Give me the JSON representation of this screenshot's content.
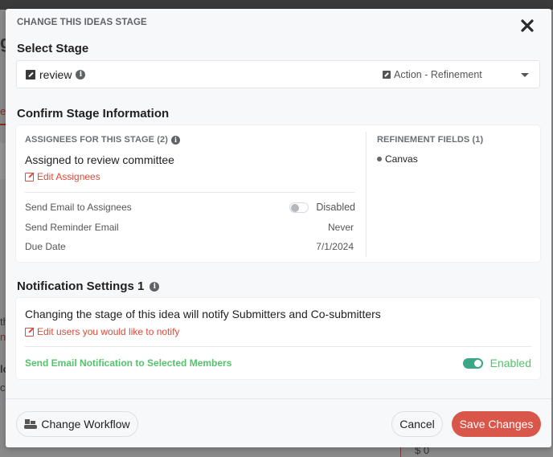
{
  "background": {
    "fragments": [
      "g",
      "ea",
      "e",
      "v",
      "th",
      "n|",
      "lc",
      "c",
      "$ 0"
    ]
  },
  "modal": {
    "eyebrow": "CHANGE THIS IDEAS STAGE",
    "close_icon": "close-icon",
    "select_stage": {
      "title": "Select Stage",
      "selected_stage": "review",
      "stage_type": "Action - Refinement"
    },
    "confirm": {
      "title": "Confirm Stage Information",
      "assignees_header": "ASSIGNEES FOR THIS STAGE (2)",
      "assigned_text": "Assigned to review committee",
      "edit_assignees": "Edit Assignees",
      "rows": [
        {
          "label": "Send Email to Assignees",
          "value": "Disabled",
          "toggle": false
        },
        {
          "label": "Send Reminder Email",
          "value": "Never"
        },
        {
          "label": "Due Date",
          "value": "7/1/2024"
        }
      ],
      "refinement_header": "REFINEMENT FIELDS (1)",
      "refinement_fields": [
        "Canvas"
      ]
    },
    "notifications": {
      "title": "Notification Settings 1",
      "description": "Changing the stage of this idea will notify Submitters and Co-submitters",
      "edit_users": "Edit users you would like to notify",
      "send_email_label": "Send Email Notification to Selected Members",
      "send_email_state": "Enabled",
      "send_email_enabled": true
    },
    "footer": {
      "change_workflow": "Change Workflow",
      "cancel": "Cancel",
      "save": "Save Changes"
    }
  },
  "colors": {
    "accent_red": "#d9574a",
    "link_red": "#d94b3a",
    "success_green": "#55c26c",
    "toggle_green": "#3aa789"
  }
}
